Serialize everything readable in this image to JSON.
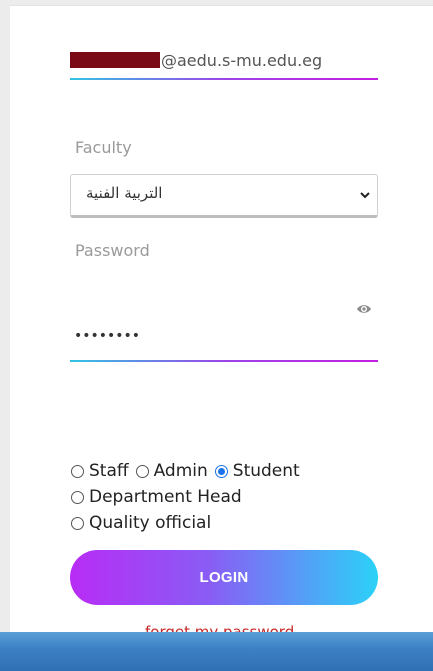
{
  "email": {
    "domain_suffix": "@aedu.s-mu.edu.eg"
  },
  "faculty": {
    "label": "Faculty",
    "selected": "التربية الفنية"
  },
  "password": {
    "label": "Password",
    "value": "••••••••"
  },
  "roles": {
    "options": [
      "Staff",
      "Admin",
      "Student",
      "Department Head",
      "Quality official"
    ],
    "selected": "Student"
  },
  "login_label": "LOGIN",
  "forgot_label": "forget my password",
  "colors": {
    "accent_start": "#b82cf5",
    "accent_end": "#2bd2f7",
    "link": "#c62828",
    "radio_checked": "#1a73e8"
  }
}
